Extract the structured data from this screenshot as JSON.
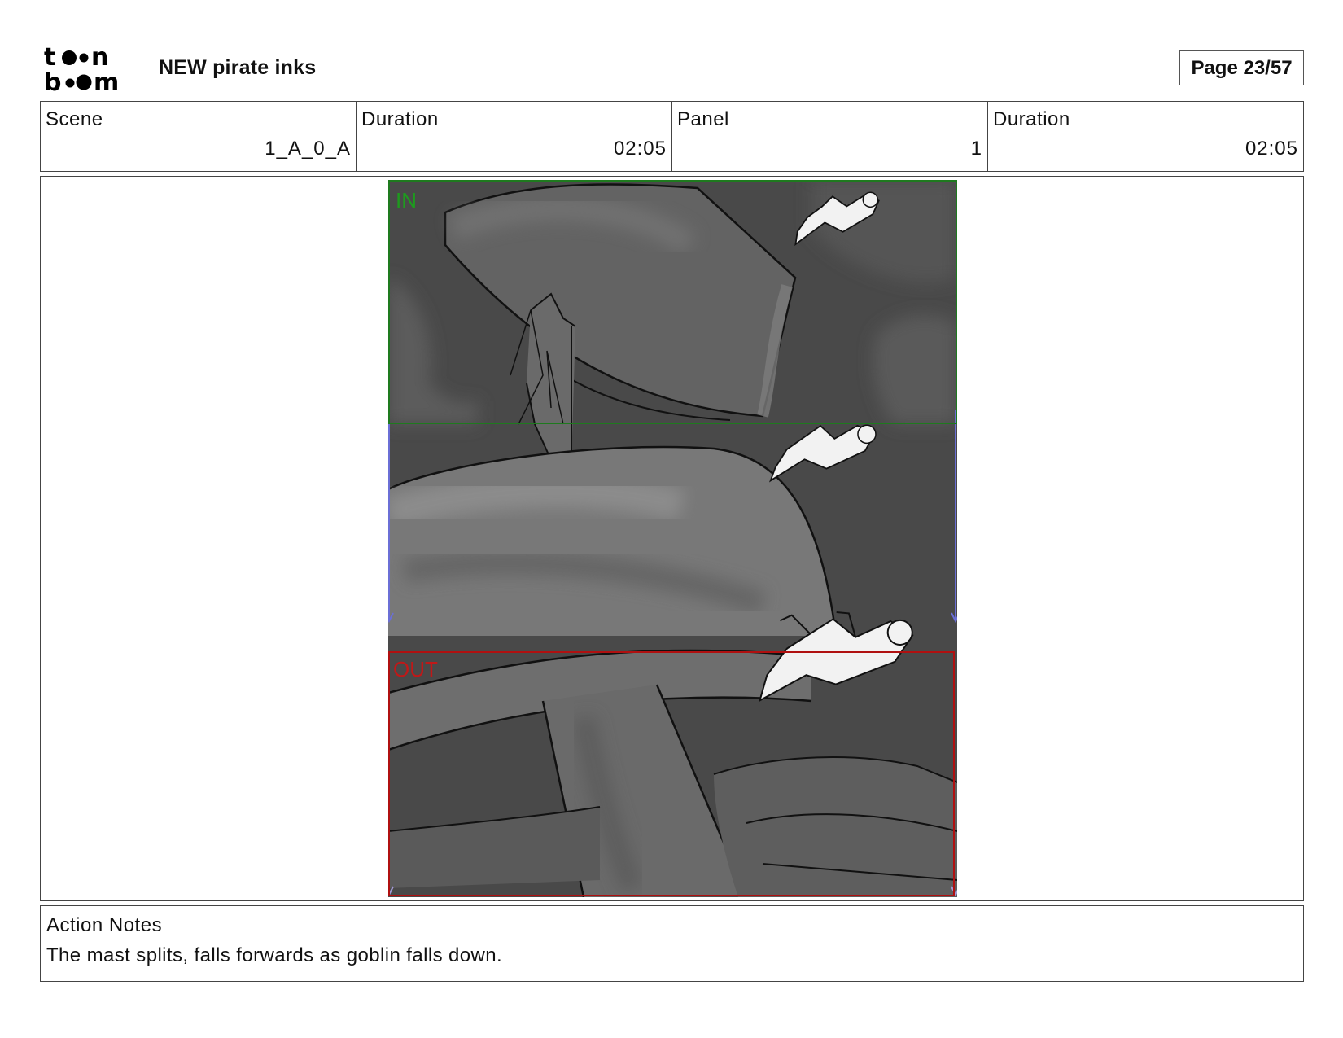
{
  "header": {
    "logo_icon": "toon-boom-logo",
    "logo_text": "toon boom",
    "project_title": "NEW pirate inks",
    "page_label": "Page 23/57"
  },
  "info": [
    {
      "label": "Scene",
      "value": "1_A_0_A"
    },
    {
      "label": "Duration",
      "value": "02:05"
    },
    {
      "label": "Panel",
      "value": "1"
    },
    {
      "label": "Duration",
      "value": "02:05"
    }
  ],
  "panel": {
    "in_label": "IN",
    "out_label": "OUT",
    "colors": {
      "in_frame": "#1e7a1e",
      "out_frame": "#b01010",
      "camera_path": "#6b6fd6",
      "background": "#4a4a4a"
    }
  },
  "notes": {
    "label": "Action Notes",
    "text": "The mast splits, falls forwards as goblin falls down."
  }
}
